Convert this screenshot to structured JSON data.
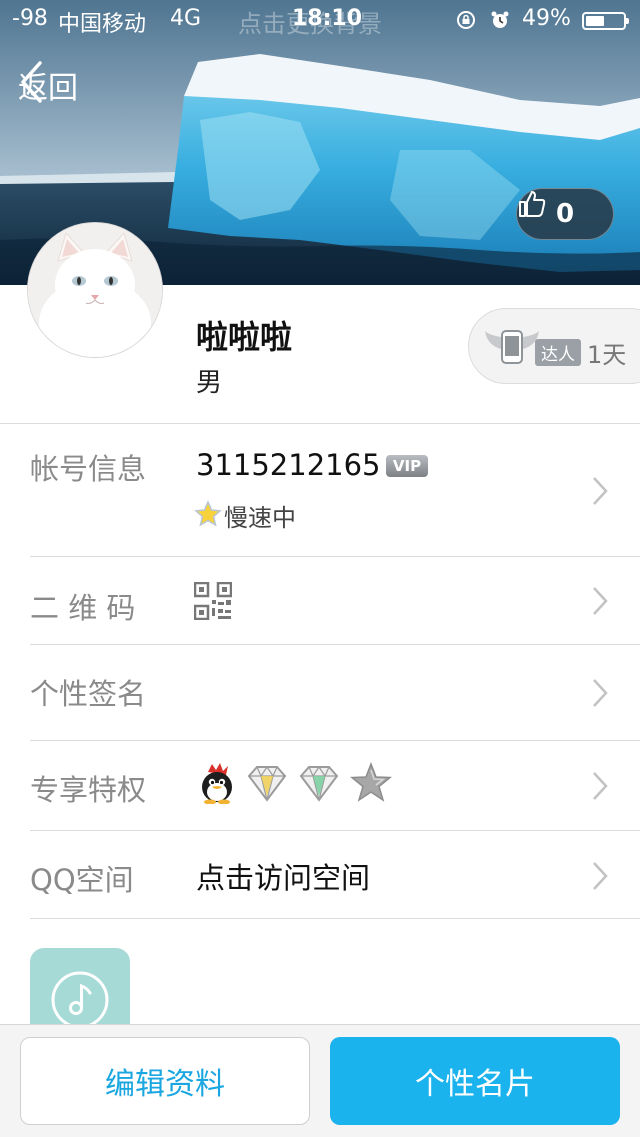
{
  "status_bar": {
    "signal": "-98",
    "carrier": "中国移动",
    "network": "4G",
    "time": "18:10",
    "battery_percent": "49%",
    "battery_level": 0.49,
    "icons": [
      "rotation-lock-icon",
      "alarm-icon",
      "battery-icon"
    ]
  },
  "cover": {
    "change_hint": "点击更换背景"
  },
  "nav": {
    "back_label": "返回",
    "back_icon": "chevron-left-icon"
  },
  "like": {
    "icon": "thumbs-up-icon",
    "count": "0"
  },
  "profile": {
    "name": "啦啦啦",
    "gender": "男",
    "daren": {
      "icon": "winged-phone-icon",
      "tag": "达人",
      "days": "1天"
    }
  },
  "rows": {
    "account": {
      "label": "帐号信息",
      "number": "3115212165",
      "vip": "VIP",
      "speed_status": "慢速中"
    },
    "qrcode": {
      "label": "二 维 码",
      "icon": "qr-code-icon"
    },
    "signature": {
      "label": "个性签名"
    },
    "privileges": {
      "label": "专享特权",
      "icons": [
        "qq-penguin-icon",
        "gold-diamond-icon",
        "green-diamond-icon",
        "gray-star-icon"
      ]
    },
    "qzone": {
      "label": "QQ空间",
      "value": "点击访问空间"
    }
  },
  "music_tile": {
    "icon": "music-note-icon"
  },
  "actions": {
    "edit_label": "编辑资料",
    "card_label": "个性名片"
  },
  "colors": {
    "accent": "#1ab3ee",
    "accent_text": "#1aa6e0",
    "label_gray": "#8a8a8a",
    "divider": "#dcdcdc"
  }
}
